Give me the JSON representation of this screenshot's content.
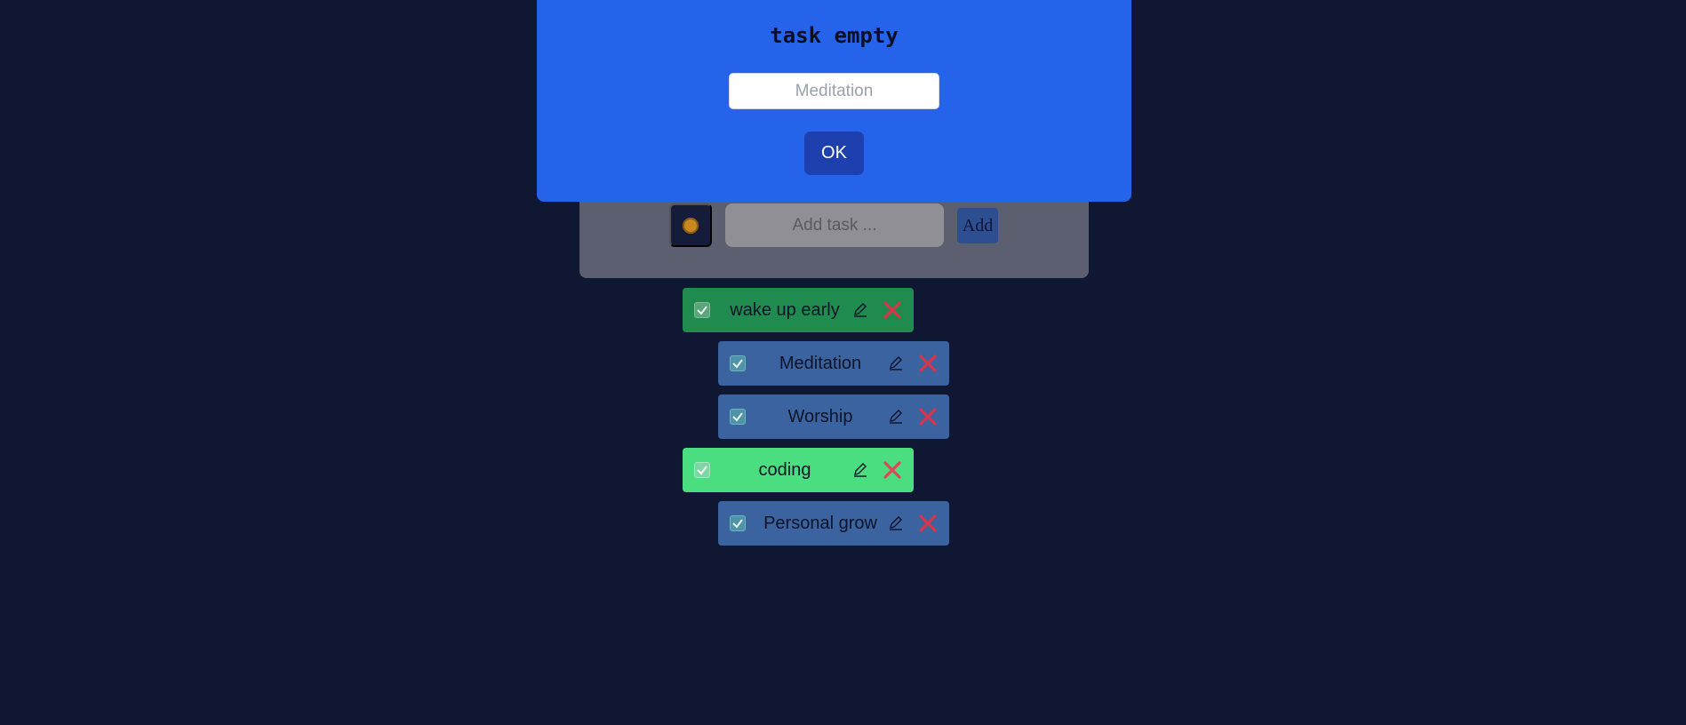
{
  "colors": {
    "background": "#0f1733",
    "modal": "#2563eb",
    "ok_button": "#1e40af",
    "task_main_done": "#1f8b4e",
    "task_main_active": "#4ade80",
    "task_sub": "#3a63a0",
    "delete": "#d9344a"
  },
  "header": {
    "theme_icon": "sun-icon",
    "input_placeholder": "Add task ...",
    "add_label": "Add"
  },
  "tasks": [
    {
      "label": "wake up early",
      "level": "main",
      "checked": true
    },
    {
      "label": "Meditation",
      "level": "sub",
      "checked": true
    },
    {
      "label": "Worship",
      "level": "sub",
      "checked": true
    },
    {
      "label": "coding",
      "level": "main",
      "checked": true
    },
    {
      "label": "Personal grow",
      "level": "sub",
      "checked": true
    }
  ],
  "modal": {
    "title": "task empty",
    "input_placeholder": "Meditation",
    "ok_label": "OK"
  }
}
